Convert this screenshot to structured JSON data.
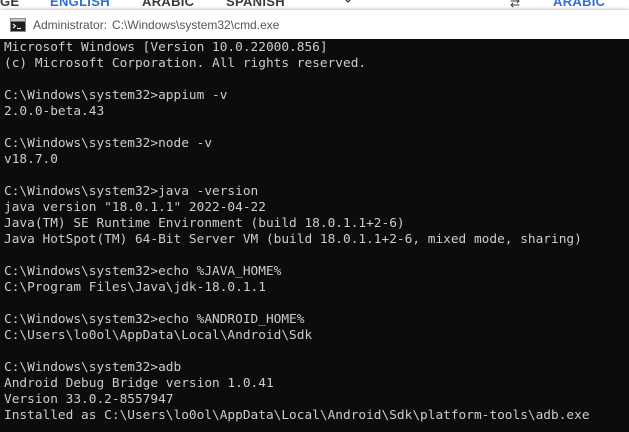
{
  "background": {
    "tabs": [
      {
        "label": "GE"
      },
      {
        "label": "ENGLISH"
      },
      {
        "label": "ARABIC"
      },
      {
        "label": "SPANISH"
      },
      {
        "label": "ARABIC"
      }
    ]
  },
  "window": {
    "title_user": "Administrator:",
    "title_path": "C:\\Windows\\system32\\cmd.exe",
    "icon": "cmd-icon"
  },
  "console": {
    "lines": [
      "Microsoft Windows [Version 10.0.22000.856]",
      "(c) Microsoft Corporation. All rights reserved.",
      "",
      "C:\\Windows\\system32>appium -v",
      "2.0.0-beta.43",
      "",
      "C:\\Windows\\system32>node -v",
      "v18.7.0",
      "",
      "C:\\Windows\\system32>java -version",
      "java version \"18.0.1.1\" 2022-04-22",
      "Java(TM) SE Runtime Environment (build 18.0.1.1+2-6)",
      "Java HotSpot(TM) 64-Bit Server VM (build 18.0.1.1+2-6, mixed mode, sharing)",
      "",
      "C:\\Windows\\system32>echo %JAVA_HOME%",
      "C:\\Program Files\\Java\\jdk-18.0.1.1",
      "",
      "C:\\Windows\\system32>echo %ANDROID_HOME%",
      "C:\\Users\\lo0ol\\AppData\\Local\\Android\\Sdk",
      "",
      "C:\\Windows\\system32>adb",
      "Android Debug Bridge version 1.0.41",
      "Version 33.0.2-8557947",
      "Installed as C:\\Users\\lo0ol\\AppData\\Local\\Android\\Sdk\\platform-tools\\adb.exe"
    ]
  },
  "colors": {
    "console_bg": "#0c0c0c",
    "console_text": "#cccccc",
    "titlebar_bg": "#ffffff",
    "tab_active": "#2f6fd6"
  }
}
